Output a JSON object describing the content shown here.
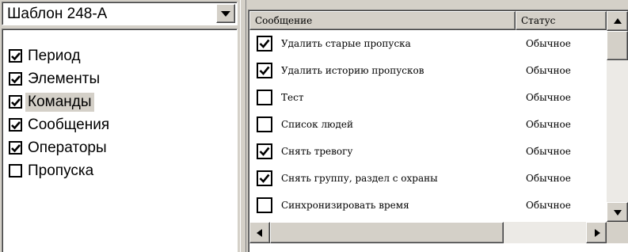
{
  "template_select": {
    "value": "Шаблон 248-А"
  },
  "categories": [
    {
      "label": "Период",
      "checked": true,
      "selected": false
    },
    {
      "label": "Элементы",
      "checked": true,
      "selected": false
    },
    {
      "label": "Команды",
      "checked": true,
      "selected": true
    },
    {
      "label": "Сообщения",
      "checked": true,
      "selected": false
    },
    {
      "label": "Операторы",
      "checked": true,
      "selected": false
    },
    {
      "label": "Пропуска",
      "checked": false,
      "selected": false
    }
  ],
  "grid": {
    "columns": [
      {
        "label": "Сообщение"
      },
      {
        "label": "Статус"
      }
    ],
    "rows": [
      {
        "checked": true,
        "message": "Удалить старые пропуска",
        "status": "Обычное"
      },
      {
        "checked": true,
        "message": "Удалить историю пропусков",
        "status": "Обычное"
      },
      {
        "checked": false,
        "message": "Тест",
        "status": "Обычное"
      },
      {
        "checked": false,
        "message": "Список людей",
        "status": "Обычное"
      },
      {
        "checked": true,
        "message": "Снять тревогу",
        "status": "Обычное"
      },
      {
        "checked": true,
        "message": "Снять группу, раздел с охраны",
        "status": "Обычное"
      },
      {
        "checked": false,
        "message": "Синхронизировать время",
        "status": "Обычное"
      }
    ]
  },
  "colors": {
    "face": "#d4d0c8",
    "window": "#ffffff",
    "shadow": "#808080",
    "text": "#000000"
  }
}
